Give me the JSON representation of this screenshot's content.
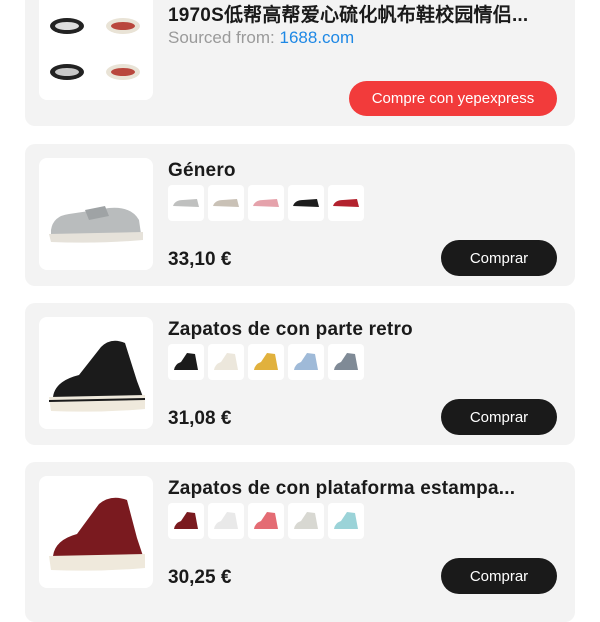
{
  "top_card": {
    "title": "1970S低帮高帮爱心硫化帆布鞋校园情侣...",
    "source_label": "Sourced from:",
    "source_link": "1688.com",
    "cta": "Compre con yepexpress"
  },
  "products": [
    {
      "title": "Género",
      "price": "33,10 €",
      "button": "Comprar",
      "variant_colors": [
        "#bfc0bf",
        "#c9c1b6",
        "#e5a2ab",
        "#1d1d1d",
        "#b3222e"
      ]
    },
    {
      "title": "Zapatos de con parte retro",
      "price": "31,08 €",
      "button": "Comprar",
      "variant_colors": [
        "#1b1b1b",
        "#ece7dc",
        "#e1b13d",
        "#9fbad8",
        "#7f8a96"
      ]
    },
    {
      "title": "Zapatos de con plataforma estampa...",
      "price": "30,25 €",
      "button": "Comprar",
      "variant_colors": [
        "#7a1a1f",
        "#e9e9e9",
        "#e46c74",
        "#d8d8d2",
        "#9bd3d8"
      ]
    }
  ],
  "colors": {
    "cta_red": "#f23b3b",
    "link_blue": "#1e88e5",
    "button_dark": "#1a1a1a"
  }
}
